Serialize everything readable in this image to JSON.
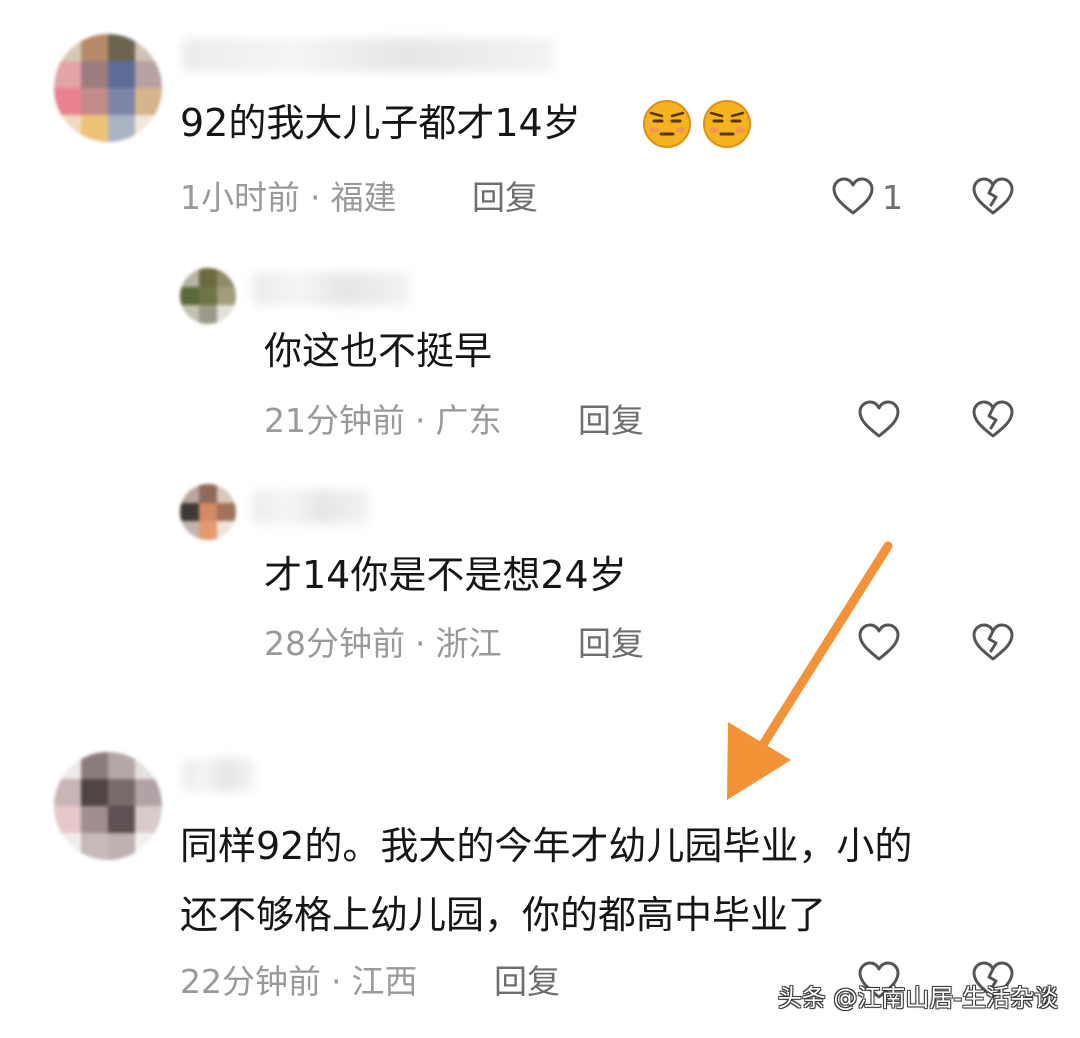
{
  "comments": [
    {
      "text": "92的我大儿子都才14岁",
      "emojis": [
        "grimace-emoji",
        "grimace-emoji"
      ],
      "time": "1小时前",
      "location": "福建",
      "reply_label": "回复",
      "like_count": "1",
      "replies": [
        {
          "text": "你这也不挺早",
          "time": "21分钟前",
          "location": "广东",
          "reply_label": "回复"
        },
        {
          "text": "才14你是不是想24岁",
          "time": "28分钟前",
          "location": "浙江",
          "reply_label": "回复"
        }
      ]
    },
    {
      "text_line1": "同样92的。我大的今年才幼儿园毕业，小的",
      "text_line2": "还不够格上幼儿园，你的都高中毕业了",
      "time": "22分钟前",
      "location": "江西",
      "reply_label": "回复"
    }
  ],
  "separator": "·",
  "watermark": "头条 @江南山居-生活杂谈",
  "colors": {
    "arrow": "#f39237",
    "meta_text": "#9a9a9a",
    "reply_text": "#6e6e6e",
    "body_text": "#161616"
  },
  "icons": {
    "like": "heart-outline-icon",
    "dislike": "broken-heart-icon",
    "emoji": "grimace-emoji"
  }
}
